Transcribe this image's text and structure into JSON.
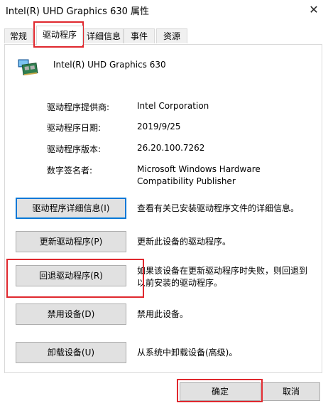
{
  "window": {
    "title": "Intel(R) UHD Graphics 630 属性",
    "close_glyph": "✕"
  },
  "tabs": [
    {
      "label": "常规"
    },
    {
      "label": "驱动程序",
      "active": true
    },
    {
      "label": "详细信息"
    },
    {
      "label": "事件"
    },
    {
      "label": "资源"
    }
  ],
  "device": {
    "icon": "display-adapter-icon",
    "name": "Intel(R) UHD Graphics 630"
  },
  "driver_info": {
    "provider_label": "驱动程序提供商:",
    "provider_value": "Intel Corporation",
    "date_label": "驱动程序日期:",
    "date_value": "2019/9/25",
    "version_label": "驱动程序版本:",
    "version_value": "26.20.100.7262",
    "signer_label": "数字签名者:",
    "signer_value_line1": "Microsoft Windows Hardware",
    "signer_value_line2": "Compatibility Publisher"
  },
  "actions": {
    "details_label": "驱动程序详细信息(I)",
    "details_desc": "查看有关已安装驱动程序文件的详细信息。",
    "update_label": "更新驱动程序(P)",
    "update_desc": "更新此设备的驱动程序。",
    "rollback_label": "回退驱动程序(R)",
    "rollback_desc_line1": "如果该设备在更新驱动程序时失败，则回退到",
    "rollback_desc_line2": "以前安装的驱动程序。",
    "disable_label": "禁用设备(D)",
    "disable_desc": "禁用此设备。",
    "uninstall_label": "卸载设备(U)",
    "uninstall_desc": "从系统中卸载设备(高级)。"
  },
  "footer": {
    "ok_label": "确定",
    "cancel_label": "取消"
  },
  "colors": {
    "highlight": "#e0282e",
    "focus": "#0078d7"
  }
}
